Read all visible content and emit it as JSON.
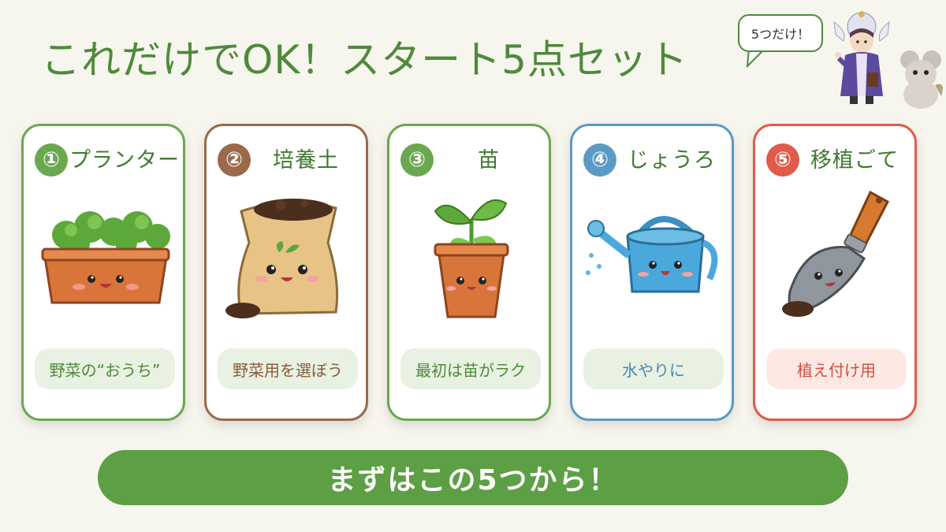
{
  "title": "これだけでOK！スタート5点セット",
  "bubble": "5つだけ！",
  "cards": [
    {
      "number": "①",
      "label": "プランター",
      "caption": "野菜の“おうち”",
      "accent": "#6aa84f",
      "text": "#3f7a2f",
      "pill_bg": "#e8f1e2",
      "pill_text": "#4e8a3a",
      "icon": "planter-icon"
    },
    {
      "number": "②",
      "label": "培養土",
      "caption": "野菜用を選ぼう",
      "accent": "#9a6a4b",
      "text": "#3f7a2f",
      "pill_bg": "#e8f1e2",
      "pill_text": "#8a5a3c",
      "icon": "soil-bag-icon"
    },
    {
      "number": "③",
      "label": "苗",
      "caption": "最初は苗がラク",
      "accent": "#6aa84f",
      "text": "#3f7a2f",
      "pill_bg": "#e8f1e2",
      "pill_text": "#4e8a3a",
      "icon": "seedling-icon"
    },
    {
      "number": "④",
      "label": "じょうろ",
      "caption": "水やりに",
      "accent": "#5b9ac4",
      "text": "#3f7a2f",
      "pill_bg": "#e8f1e2",
      "pill_text": "#4a86b0",
      "icon": "watering-can-icon"
    },
    {
      "number": "⑤",
      "label": "移植ごて",
      "caption": "植え付け用",
      "accent": "#e25a4a",
      "text": "#3f7a2f",
      "pill_bg": "#fde8e4",
      "pill_text": "#d0503f",
      "icon": "trowel-icon"
    }
  ],
  "cta": "まずはこの5つから！"
}
